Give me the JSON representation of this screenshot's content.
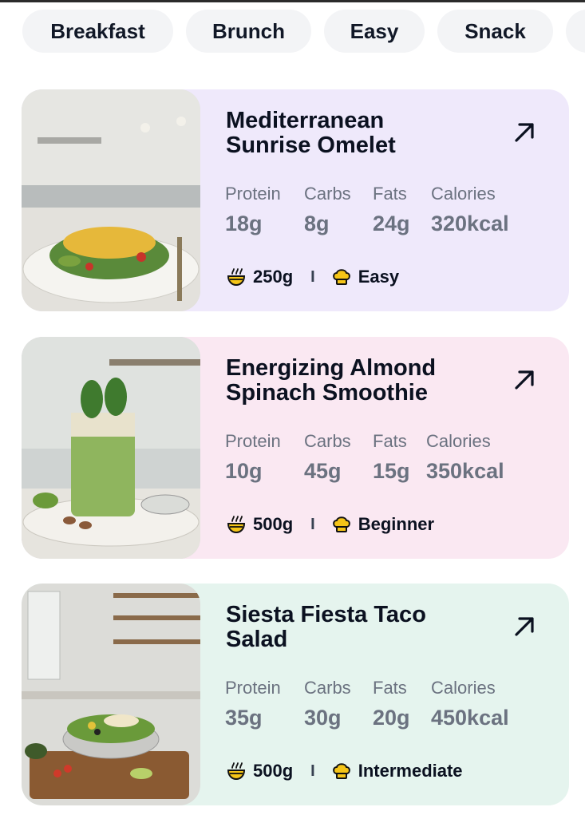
{
  "filters": {
    "chips": [
      "Breakfast",
      "Brunch",
      "Easy",
      "Snack",
      ""
    ]
  },
  "nutrient_labels": {
    "protein": "Protein",
    "carbs": "Carbs",
    "fats": "Fats",
    "calories": "Calories"
  },
  "recipes": [
    {
      "title": "Mediterranean Sunrise Omelet",
      "protein": "18g",
      "carbs": "8g",
      "fats": "24g",
      "calories": "320kcal",
      "weight": "250g",
      "difficulty": "Easy",
      "image": "omelet-photo",
      "bg_color": "#efe9fb"
    },
    {
      "title": "Energizing Almond Spinach Smoothie",
      "protein": "10g",
      "carbs": "45g",
      "fats": "15g",
      "calories": "350kcal",
      "weight": "500g",
      "difficulty": "Beginner",
      "image": "smoothie-photo",
      "bg_color": "#fae8f2"
    },
    {
      "title": "Siesta Fiesta Taco Salad",
      "protein": "35g",
      "carbs": "30g",
      "fats": "20g",
      "calories": "450kcal",
      "weight": "500g",
      "difficulty": "Intermediate",
      "image": "taco-salad-photo",
      "bg_color": "#e5f4ee"
    }
  ],
  "icons": {
    "open": "arrow-up-right-icon",
    "weight": "bowl-icon",
    "difficulty": "chef-hat-icon"
  },
  "colors": {
    "accent_icon": "#f5c518",
    "muted_text": "#6b7280"
  }
}
